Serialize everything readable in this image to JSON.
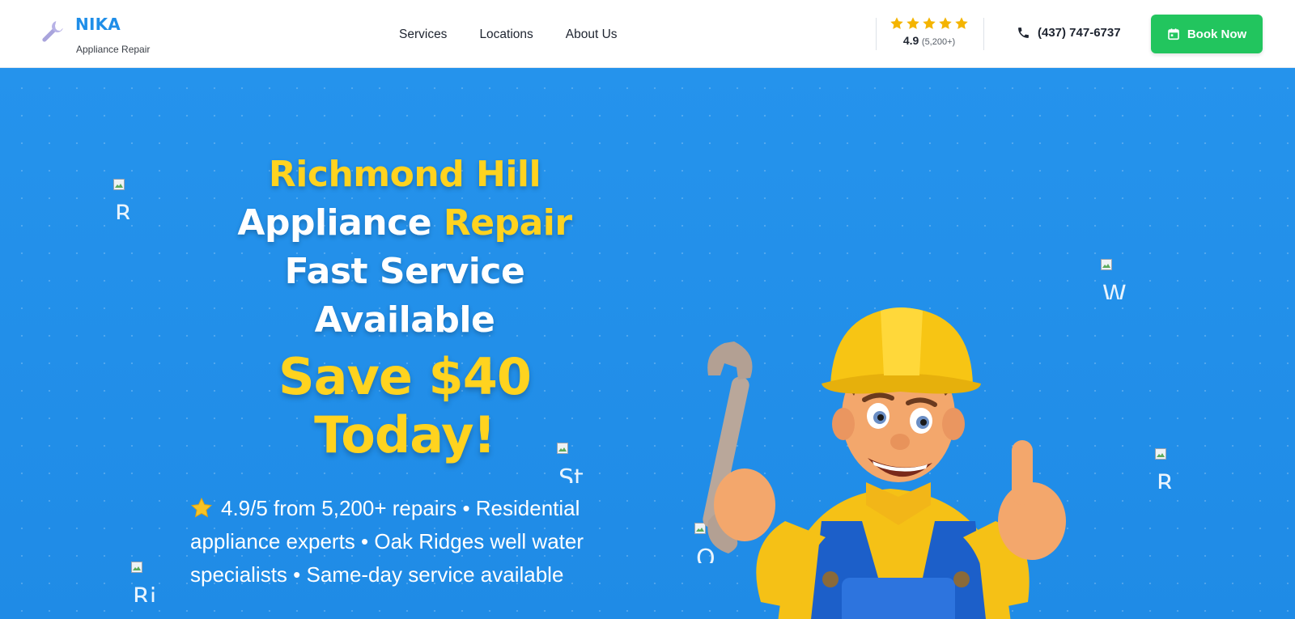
{
  "brand": {
    "name": "NIKA",
    "tagline": "Appliance Repair",
    "logo_icon": "wrench-icon",
    "color": "#1f8ee8"
  },
  "nav": {
    "items": [
      {
        "label": "Services"
      },
      {
        "label": "Locations"
      },
      {
        "label": "About Us"
      }
    ]
  },
  "rating": {
    "stars": 5,
    "value": "4.9",
    "count": "(5,200+)",
    "star_color": "#f4b400"
  },
  "contact": {
    "phone_icon": "phone-icon",
    "phone": "(437) 747-6737"
  },
  "cta": {
    "label": "Book Now",
    "icon": "calendar-icon",
    "color": "#22c55e"
  },
  "hero": {
    "title_line1": "Richmond Hill",
    "title_line2a": "Appliance ",
    "title_line2b": "Repair",
    "title_line3": "Fast Service",
    "title_line4": "Available",
    "save_line1": "Save $40",
    "save_line2": "Today!",
    "description": "4.9/5 from 5,200+ repairs • Residential appliance experts • Oak Ridges well water specialists • Same-day service available",
    "description_icon": "star-emoji-icon",
    "background": "#2190ea",
    "accent": "#ffd31f"
  },
  "broken_images": [
    {
      "text": "R"
    },
    {
      "text": "W"
    },
    {
      "text": "St"
    },
    {
      "text": "R"
    },
    {
      "text": "Q"
    },
    {
      "text": "Ri"
    }
  ],
  "mascot": {
    "icon": "repairman-mascot-icon"
  }
}
